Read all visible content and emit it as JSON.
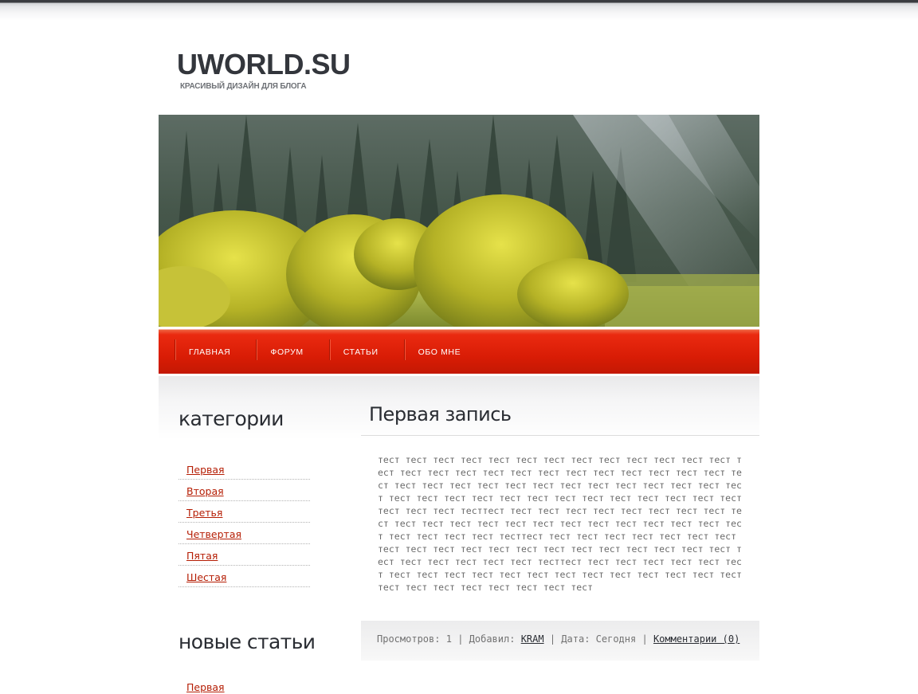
{
  "site": {
    "title": "UWORLD.SU",
    "tagline": "КРАСИВЫЙ ДИЗАЙН ДЛЯ БЛОГА"
  },
  "nav": {
    "items": [
      {
        "label": "ГЛАВНАЯ"
      },
      {
        "label": "ФОРУМ"
      },
      {
        "label": "СТАТЬИ"
      },
      {
        "label": "ОБО МНЕ"
      }
    ]
  },
  "sidebar": {
    "categories_title": "категории",
    "categories": [
      {
        "label": "Первая"
      },
      {
        "label": "Вторая"
      },
      {
        "label": "Третья"
      },
      {
        "label": "Четвертая"
      },
      {
        "label": "Пятая"
      },
      {
        "label": "Шестая"
      }
    ],
    "new_articles_title": "новые статьи",
    "new_articles": [
      {
        "label": "Первая"
      }
    ]
  },
  "post": {
    "title": "Первая запись",
    "body": "тест тест тест тест тест тест тест тест тест тест тест тест тест тест тест тест тест тест тест тест тест тест тест тест тест тест тест тест тест тест тест тест тест тест тест тест тест тест тест тест тест тест тест тест тест тест тест тест тест тест тест тест тест тест тест тест тесттест тест тест тест тест тест тест тест тест тест тест тест тест тест тест тест тест тест тест тест тест тест тест тест тест тест тест тесттест тест тест тест тест тест тест тест тест тест тест тест тест тест тест тест тест тест тест тест тест тест тест тест тест тест тест тесттест тест тест тест тест тест тест тест тест тест тест тест тест тест тест тест тест тест тест тест тест тест тест тест тест тест тест тест",
    "meta": {
      "views_label": "Просмотров:",
      "views": "1",
      "added_label": "Добавил:",
      "author": "KRAM",
      "date_label": "Дата:",
      "date": "Сегодня",
      "separator": "|",
      "comments": "Комментарии (0)"
    }
  },
  "colors": {
    "nav_red": "#d81c05",
    "link_red": "#b51d04",
    "heading_dark": "#2a2d33"
  }
}
